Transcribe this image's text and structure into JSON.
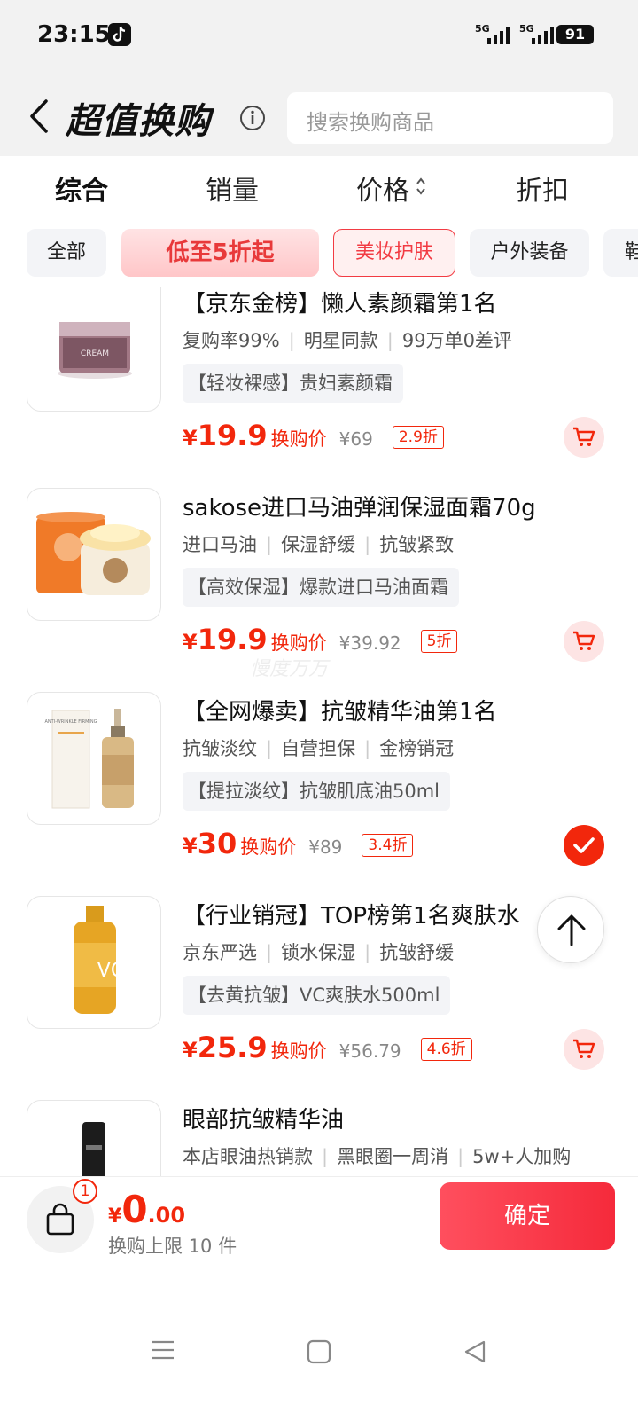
{
  "status": {
    "time": "23:15",
    "net1": "5G",
    "net2": "5G",
    "battery": "91"
  },
  "header": {
    "title": "超值换购",
    "search_placeholder": "搜索换购商品"
  },
  "sort": {
    "items": [
      "综合",
      "销量",
      "价格",
      "折扣"
    ]
  },
  "chips": [
    "全部",
    "低至5折起",
    "美妆护肤",
    "户外装备",
    "鞋"
  ],
  "products": [
    {
      "title": "【京东金榜】懒人素颜霜第1名",
      "tags": [
        "复购率99%",
        "明星同款",
        "99万单0差评"
      ],
      "promo": "【轻妆裸感】贵妇素颜霜",
      "price": "19.9",
      "price_label": "换购价",
      "original": "¥69",
      "discount": "2.9折",
      "selected": false,
      "thumb_text": "CREAM"
    },
    {
      "title": "sakose进口马油弹润保湿面霜70g",
      "tags": [
        "进口马油",
        "保湿舒缓",
        "抗皱紧致"
      ],
      "promo": "【高效保湿】爆款进口马油面霜",
      "price": "19.9",
      "price_label": "换购价",
      "original": "¥39.92",
      "discount": "5折",
      "selected": false,
      "thumb_text": ""
    },
    {
      "title": "【全网爆卖】抗皱精华油第1名",
      "tags": [
        "抗皱淡纹",
        "自营担保",
        "金榜销冠"
      ],
      "promo": "【提拉淡纹】抗皱肌底油50ml",
      "price": "30",
      "price_label": "换购价",
      "original": "¥89",
      "discount": "3.4折",
      "selected": true,
      "thumb_text": "ANTI-WRINKLE FIRMING"
    },
    {
      "title": "【行业销冠】TOP榜第1名爽肤水",
      "tags": [
        "京东严选",
        "锁水保湿",
        "抗皱舒缓"
      ],
      "promo": "【去黄抗皱】VC爽肤水500ml",
      "price": "25.9",
      "price_label": "换购价",
      "original": "¥56.79",
      "discount": "4.6折",
      "selected": false,
      "thumb_text": "VC"
    },
    {
      "title": "眼部抗皱精华油",
      "tags": [
        "本店眼油热销款",
        "黑眼圈一周消",
        "5w+人加购"
      ],
      "promo": "",
      "price": "",
      "price_label": "",
      "original": "",
      "discount": "",
      "selected": false,
      "thumb_text": ""
    }
  ],
  "watermark": "慢度万万",
  "footer": {
    "badge": "1",
    "currency": "¥",
    "total_int": "0",
    "total_dec": ".00",
    "limit": "换购上限 10 件",
    "confirm": "确定"
  },
  "colors": {
    "accent": "#f2270c",
    "confirm": "#f52a3b",
    "chip_selected": "#f23b43"
  },
  "icons": [
    "back-icon",
    "info-icon",
    "sort-arrows-icon",
    "cart-icon",
    "check-icon",
    "arrow-up-icon",
    "shopping-bag-icon",
    "menu-icon",
    "home-icon",
    "back-nav-icon"
  ]
}
